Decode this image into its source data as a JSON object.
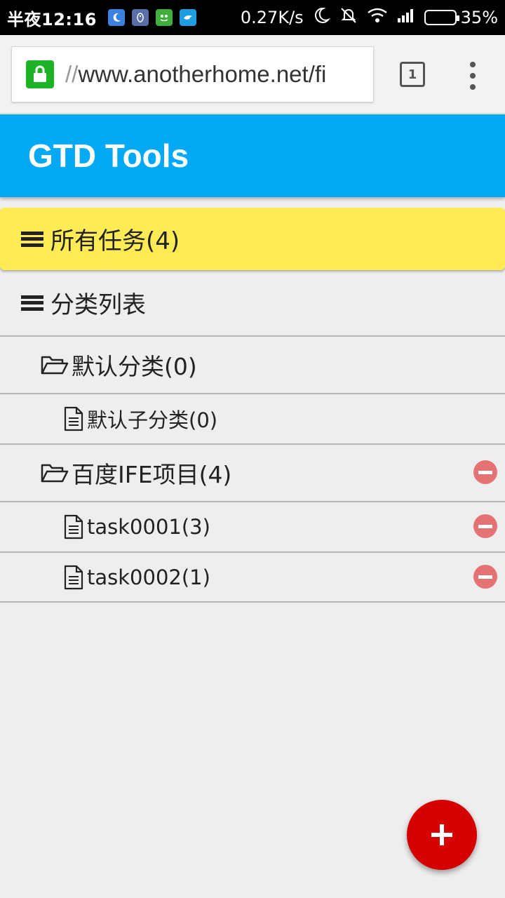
{
  "status_bar": {
    "time": "半夜12:16",
    "net_speed": "0.27K/s",
    "battery": "35%",
    "battery_level": 0.35,
    "notification_icons": [
      "moon-app-icon",
      "qq-icon",
      "frog-app-icon",
      "bird-app-icon"
    ]
  },
  "browser": {
    "url_scheme": "//",
    "url_host": "www.anotherhome.net/fi",
    "tab_count": "1"
  },
  "app": {
    "title": "GTD Tools"
  },
  "all_tasks": {
    "label": "所有任务(4)"
  },
  "category_list": {
    "heading": "分类列表",
    "items": [
      {
        "type": "folder",
        "label": "默认分类(0)",
        "removable": false
      },
      {
        "type": "file",
        "label": "默认子分类(0)",
        "removable": false
      },
      {
        "type": "folder",
        "label": "百度IFE项目(4)",
        "removable": true
      },
      {
        "type": "file",
        "label": "task0001(3)",
        "removable": true
      },
      {
        "type": "file",
        "label": "task0002(1)",
        "removable": true
      }
    ]
  },
  "colors": {
    "header": "#03a9f4",
    "selected": "#ffeb55",
    "fab": "#d50000",
    "remove": "#e57373",
    "secure": "#1db324"
  }
}
